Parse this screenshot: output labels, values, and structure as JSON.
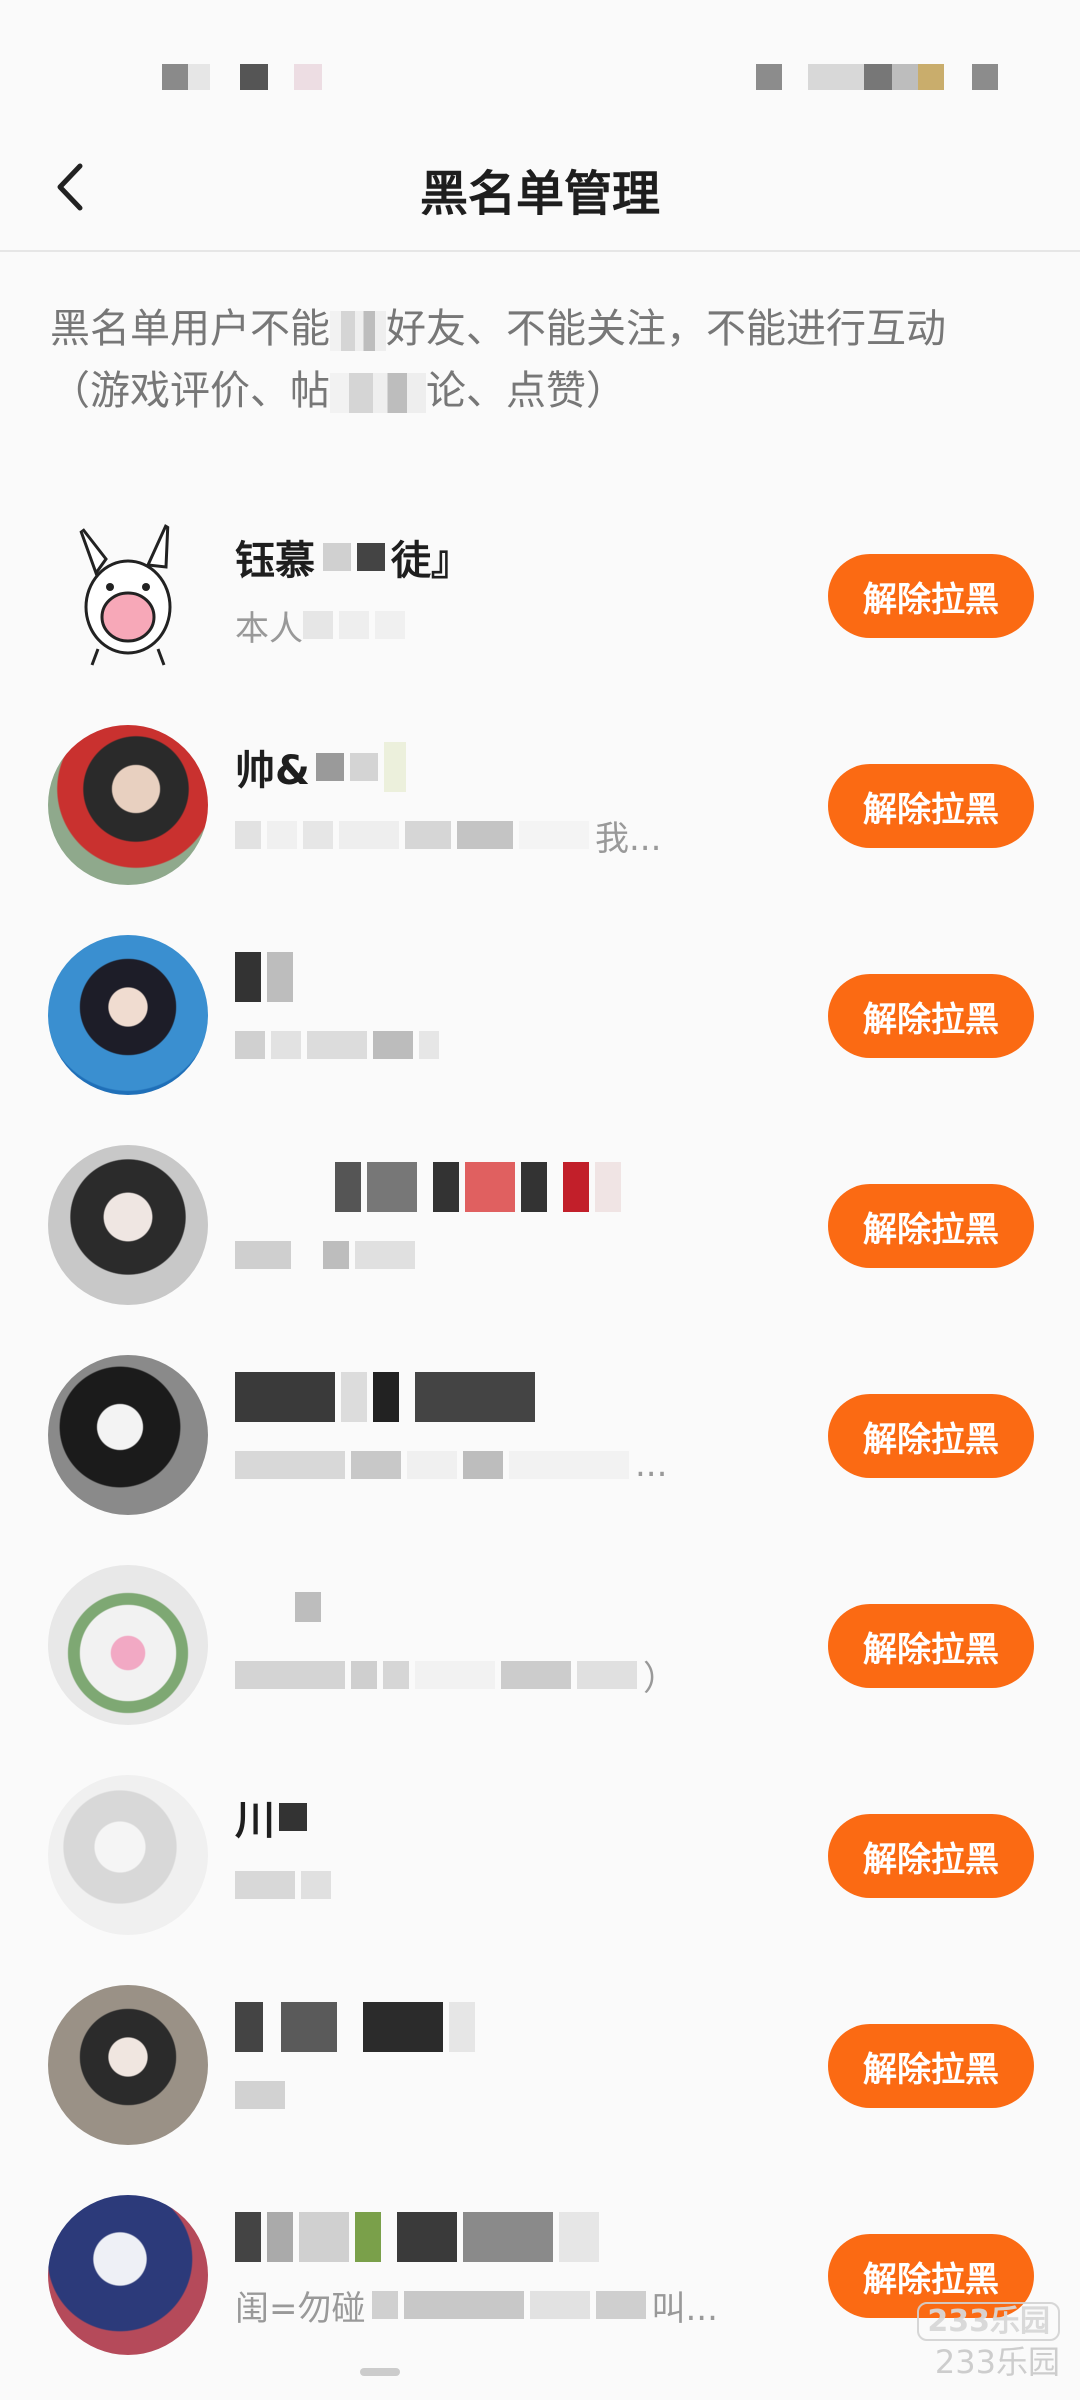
{
  "header": {
    "title": "黑名单管理",
    "back_icon": "chevron-left-icon"
  },
  "notice": {
    "line1_a": "黑名单用户不能",
    "line1_b": "好友、不能关注，不能进行互动",
    "line2_a": "（游戏评价、帖",
    "line2_b": "论、点赞）"
  },
  "list": {
    "button_label": "解除拉黑",
    "items": [
      {
        "name_a": "钰慕",
        "name_b": "徒』",
        "bio_a": "本人",
        "bio_b": ""
      },
      {
        "name_a": "帅&",
        "name_b": "",
        "bio_a": "",
        "bio_b": "我..."
      },
      {
        "name_a": "",
        "name_b": "",
        "bio_a": "",
        "bio_b": ""
      },
      {
        "name_a": "",
        "name_b": "",
        "bio_a": "",
        "bio_b": ""
      },
      {
        "name_a": "",
        "name_b": "",
        "bio_a": "",
        "bio_b": "..."
      },
      {
        "name_a": "",
        "name_b": "",
        "bio_a": "",
        "bio_b": "）"
      },
      {
        "name_a": "川",
        "name_b": "",
        "bio_a": "",
        "bio_b": ""
      },
      {
        "name_a": "",
        "name_b": "",
        "bio_a": "",
        "bio_b": ""
      },
      {
        "name_a": "",
        "name_b": "",
        "bio_a": "闺=勿碰",
        "bio_b": "叫..."
      }
    ]
  },
  "watermark": {
    "logo": "233乐园",
    "text": "233乐园"
  },
  "colors": {
    "accent": "#fb6a13",
    "background": "#fafafa"
  }
}
